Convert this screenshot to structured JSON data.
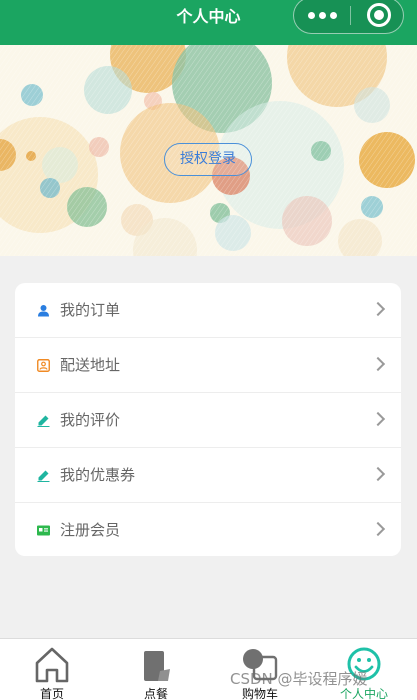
{
  "header": {
    "title": "个人中心",
    "more_icon": "more-dots-icon",
    "close_icon": "record-circle-icon",
    "bg_color": "#1ba561"
  },
  "banner": {
    "login_label": "授权登录"
  },
  "menu": {
    "items": [
      {
        "label": "我的订单",
        "icon": "user-icon"
      },
      {
        "label": "配送地址",
        "icon": "address-card-icon"
      },
      {
        "label": "我的评价",
        "icon": "pencil-icon"
      },
      {
        "label": "我的优惠券",
        "icon": "pencil-icon"
      },
      {
        "label": "注册会员",
        "icon": "member-card-icon"
      }
    ],
    "arrow_icon": "chevron-right-icon"
  },
  "tabbar": {
    "tabs": [
      {
        "label": "首页",
        "icon": "home-icon"
      },
      {
        "label": "点餐",
        "icon": "order-icon"
      },
      {
        "label": "购物车",
        "icon": "cart-icon"
      },
      {
        "label": "个人中心",
        "icon": "smile-icon"
      }
    ],
    "active_index": 3,
    "active_color": "#1ba561"
  },
  "watermark": "CSDN @毕设程序媛"
}
